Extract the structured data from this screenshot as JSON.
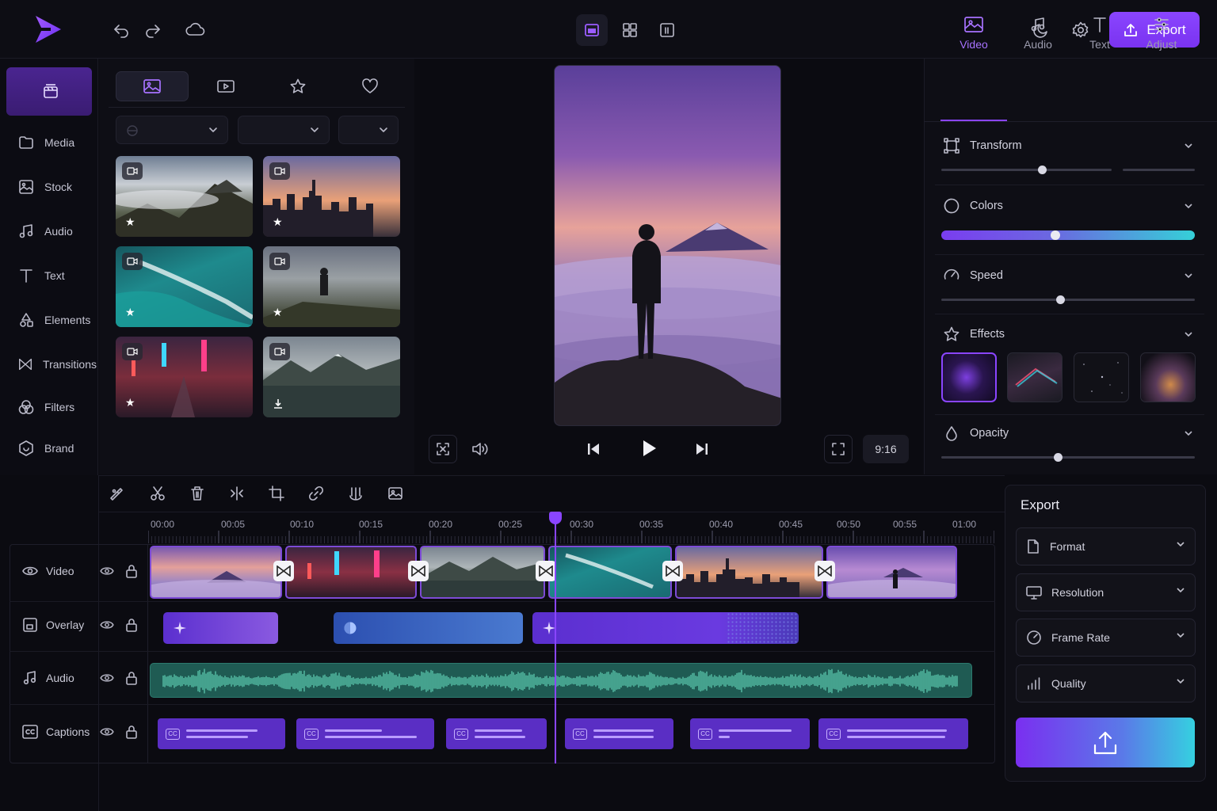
{
  "topbar": {
    "export_label": "Export"
  },
  "nav": {
    "items": [
      {
        "label": "Media",
        "icon": "folder-icon"
      },
      {
        "label": "Stock",
        "icon": "stock-icon"
      },
      {
        "label": "Audio",
        "icon": "music-icon"
      },
      {
        "label": "Text",
        "icon": "text-icon"
      },
      {
        "label": "Elements",
        "icon": "shapes-icon"
      },
      {
        "label": "Transitions",
        "icon": "transition-icon"
      },
      {
        "label": "Filters",
        "icon": "filters-icon"
      },
      {
        "label": "Brand",
        "icon": "brand-icon"
      }
    ]
  },
  "preview": {
    "aspect_label": "9:16"
  },
  "right_tabs": [
    "Video",
    "Audio",
    "Text",
    "Adjust"
  ],
  "properties": {
    "transform_label": "Transform",
    "colors_label": "Colors",
    "speed_label": "Speed",
    "effects_label": "Effects",
    "opacity_label": "Opacity",
    "transform_value": 0.59,
    "colors_value": 0.45,
    "speed_value": 0.47,
    "opacity_value": 0.46
  },
  "timeline": {
    "ticks": [
      "00:00",
      "00:05",
      "00:10",
      "00:15",
      "00:20",
      "00:25",
      "00:30",
      "00:35",
      "00:40",
      "00:45",
      "00:50",
      "00:55",
      "01:00"
    ],
    "playhead": "00:27",
    "tracks": [
      {
        "label": "Video",
        "icon": "eye-icon"
      },
      {
        "label": "Overlay",
        "icon": "overlay-icon"
      },
      {
        "label": "Audio",
        "icon": "music-icon"
      },
      {
        "label": "Captions",
        "icon": "cc-icon"
      }
    ]
  },
  "export_panel": {
    "title": "Export",
    "rows": [
      "Format",
      "Resolution",
      "Frame Rate",
      "Quality"
    ]
  },
  "colors": {
    "accent": "#8a45ff",
    "teal": "#35d0d8",
    "audio_track": "#1f5b53"
  }
}
